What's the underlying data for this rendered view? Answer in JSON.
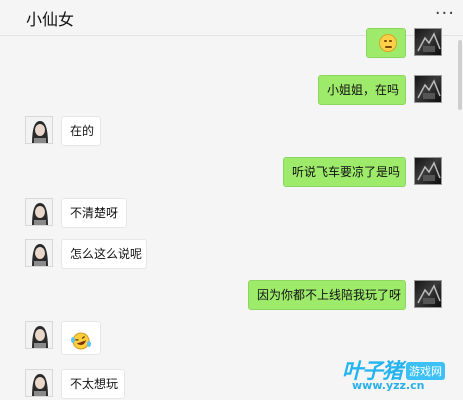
{
  "header": {
    "title": "小仙女",
    "more_label": "···"
  },
  "messages": [
    {
      "from": "me",
      "type": "emoji",
      "emoji": "awkward-face-emoji"
    },
    {
      "from": "me",
      "type": "text",
      "text": "小姐姐，在吗"
    },
    {
      "from": "her",
      "type": "text",
      "text": "在的"
    },
    {
      "from": "me",
      "type": "text",
      "text": "听说飞车要凉了是吗"
    },
    {
      "from": "her",
      "type": "text",
      "text": "不清楚呀"
    },
    {
      "from": "her",
      "type": "text",
      "text": "怎么这么说呢"
    },
    {
      "from": "me",
      "type": "text",
      "text": "因为你都不上线陪我玩了呀"
    },
    {
      "from": "her",
      "type": "emoji",
      "emoji": "laughing-tears-emoji"
    },
    {
      "from": "her",
      "type": "text",
      "text": "不太想玩"
    }
  ],
  "watermark": {
    "name": "叶子猪",
    "tag": "游戏网",
    "url": "www.yzz.cn"
  },
  "colors": {
    "outgoing_bubble": "#9eea6a",
    "incoming_bubble": "#ffffff",
    "background": "#f5f5f5",
    "watermark": "#24b4f0"
  }
}
